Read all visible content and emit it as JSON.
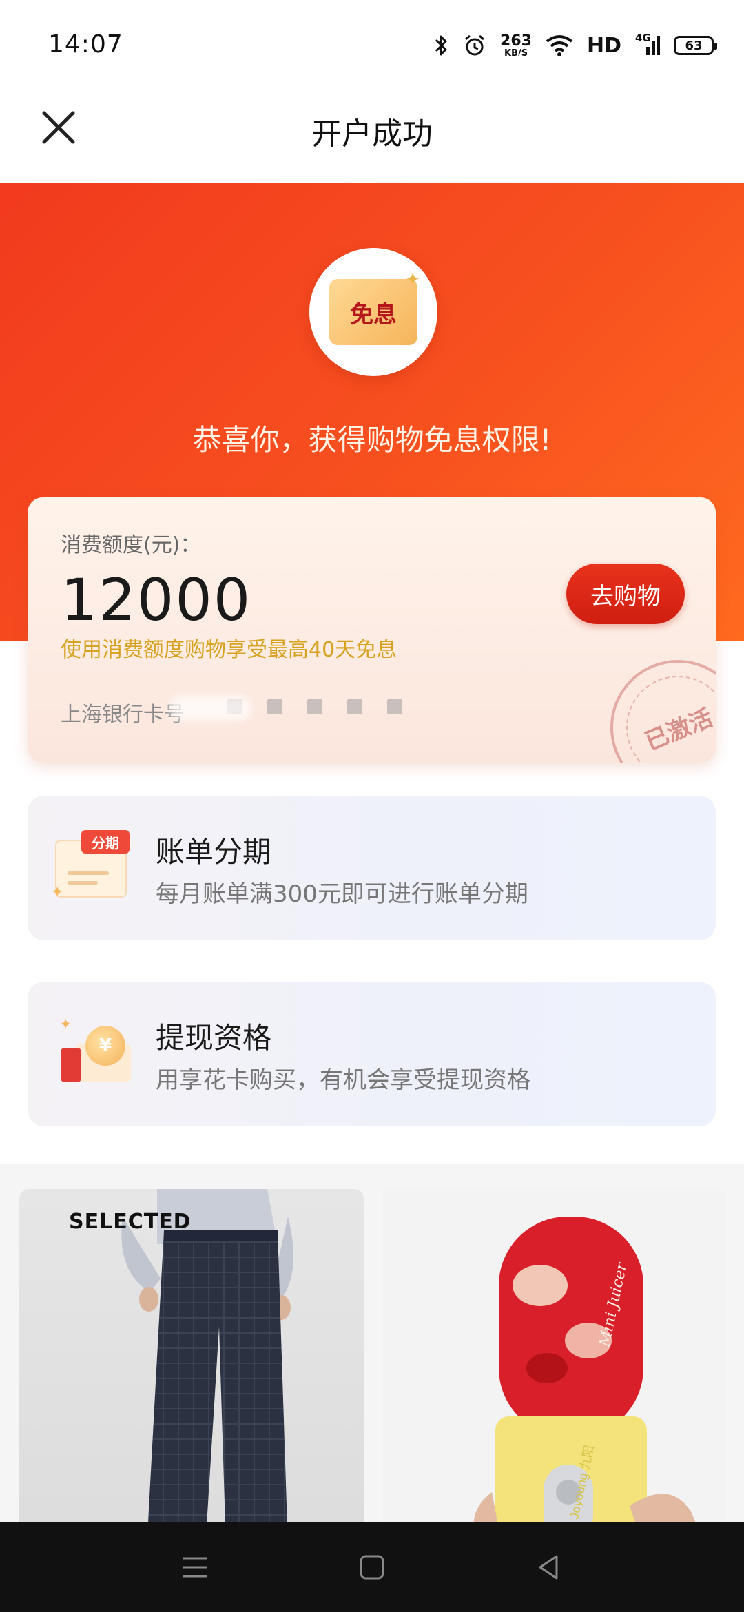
{
  "status_bar": {
    "time": "14:07",
    "network_speed": "263",
    "network_speed_unit": "KB/S",
    "hd_label": "HD",
    "signal_label": "4G",
    "battery": "63"
  },
  "nav": {
    "title": "开户成功"
  },
  "hero": {
    "badge_text": "免息",
    "congrats": "恭喜你，获得购物免息权限!",
    "bg_color": "#f23a1e"
  },
  "credit_card": {
    "label": "消费额度(元)：",
    "amount": "12000",
    "note": "使用消费额度购物享受最高40天免息",
    "bank_label": "上海银行卡号",
    "button": "去购物",
    "stamp": "已激活"
  },
  "features": [
    {
      "icon_tag": "分期",
      "title": "账单分期",
      "subtitle": "每月账单满300元即可进行账单分期"
    },
    {
      "icon_coin": "¥",
      "title": "提现资格",
      "subtitle": "用享花卡购买，有机会享受提现资格"
    }
  ],
  "products": [
    {
      "label": "SELECTED",
      "icon": "trousers-image"
    },
    {
      "label": "",
      "icon": "juicer-image",
      "print": "Mini Juicer",
      "brand": "Joyoung 九阳"
    }
  ],
  "system_nav": {
    "icons": [
      "menu-icon",
      "home-square-icon",
      "back-triangle-icon"
    ]
  }
}
